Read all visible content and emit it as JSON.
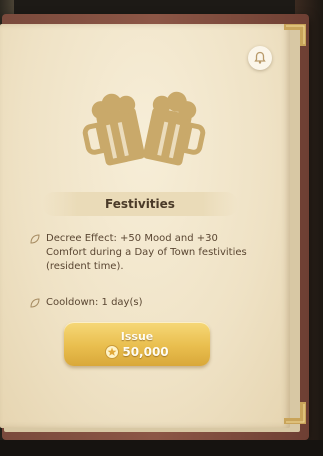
{
  "decree": {
    "title": "Festivities",
    "effect": "Decree Effect: +50 Mood and +30 Comfort during a Day of Town festivities (resident time).",
    "cooldown": "Cooldown: 1 day(s)"
  },
  "issue_button": {
    "label": "Issue",
    "cost": "50,000"
  },
  "icons": {
    "emblem": "beer-mugs-icon",
    "notification": "bell-icon",
    "bullet": "leaf-bullet-icon",
    "currency": "star-coin-icon"
  },
  "colors": {
    "page": "#efe2c5",
    "cover": "#8c5646",
    "accent_gold": "#e9be4e",
    "text": "#5a4632"
  }
}
